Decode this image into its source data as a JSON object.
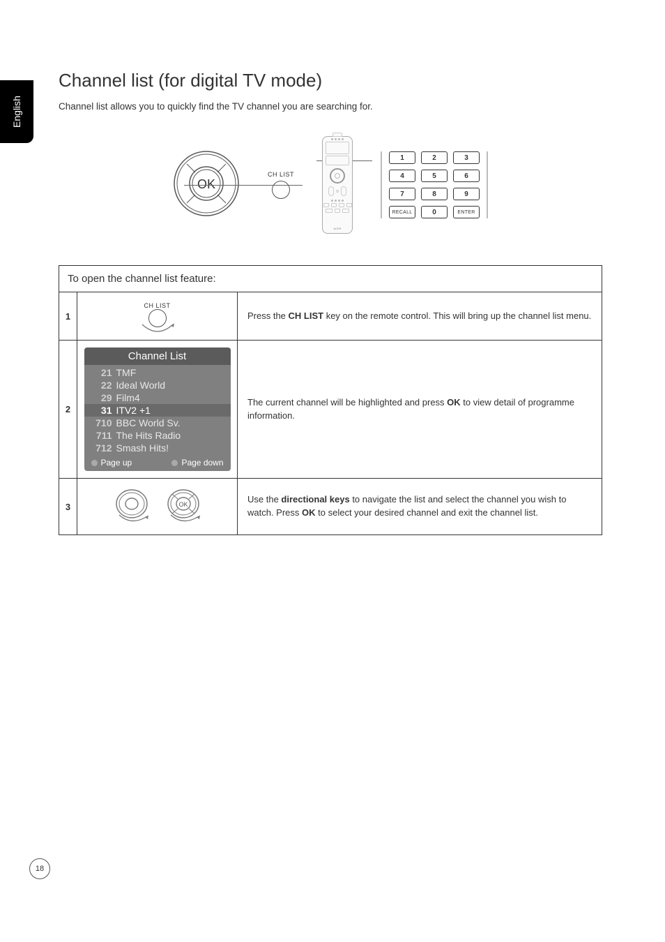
{
  "language_tab": "English",
  "title": "Channel list (for digital TV mode)",
  "intro": "Channel list allows you to quickly find the TV channel you are searching for.",
  "hero": {
    "ok_label": "OK",
    "chlist_label": "CH LIST",
    "keypad": {
      "keys": [
        "1",
        "2",
        "3",
        "4",
        "5",
        "6",
        "7",
        "8",
        "9"
      ],
      "recall": "RECALL",
      "zero": "0",
      "enter": "ENTER"
    }
  },
  "table_header": "To open the channel list feature:",
  "steps": [
    {
      "num": "1",
      "ill_label": "CH LIST",
      "desc_pre": "Press the ",
      "desc_b1": "CH LIST",
      "desc_post": " key on the remote control. This will bring up the channel list menu."
    },
    {
      "num": "2",
      "osd": {
        "title": "Channel List",
        "rows": [
          {
            "ch": "21",
            "name": "TMF",
            "sel": false
          },
          {
            "ch": "22",
            "name": "Ideal World",
            "sel": false
          },
          {
            "ch": "29",
            "name": "Film4",
            "sel": false
          },
          {
            "ch": "31",
            "name": "ITV2 +1",
            "sel": true
          },
          {
            "ch": "710",
            "name": "BBC World Sv.",
            "sel": false
          },
          {
            "ch": "711",
            "name": "The Hits Radio",
            "sel": false
          },
          {
            "ch": "712",
            "name": "Smash Hits!",
            "sel": false
          }
        ],
        "page_up": "Page up",
        "page_down": "Page down"
      },
      "desc_pre": "The current channel will be highlighted and press ",
      "desc_b1": "OK",
      "desc_post": " to view detail of programme information."
    },
    {
      "num": "3",
      "ok_label": "OK",
      "desc_pre": "Use the ",
      "desc_b1": "directional keys",
      "desc_mid": " to navigate the list and select the channel you wish to watch. Press ",
      "desc_b2": "OK",
      "desc_post": " to select your desired channel and exit the channel list."
    }
  ],
  "page_number": "18"
}
